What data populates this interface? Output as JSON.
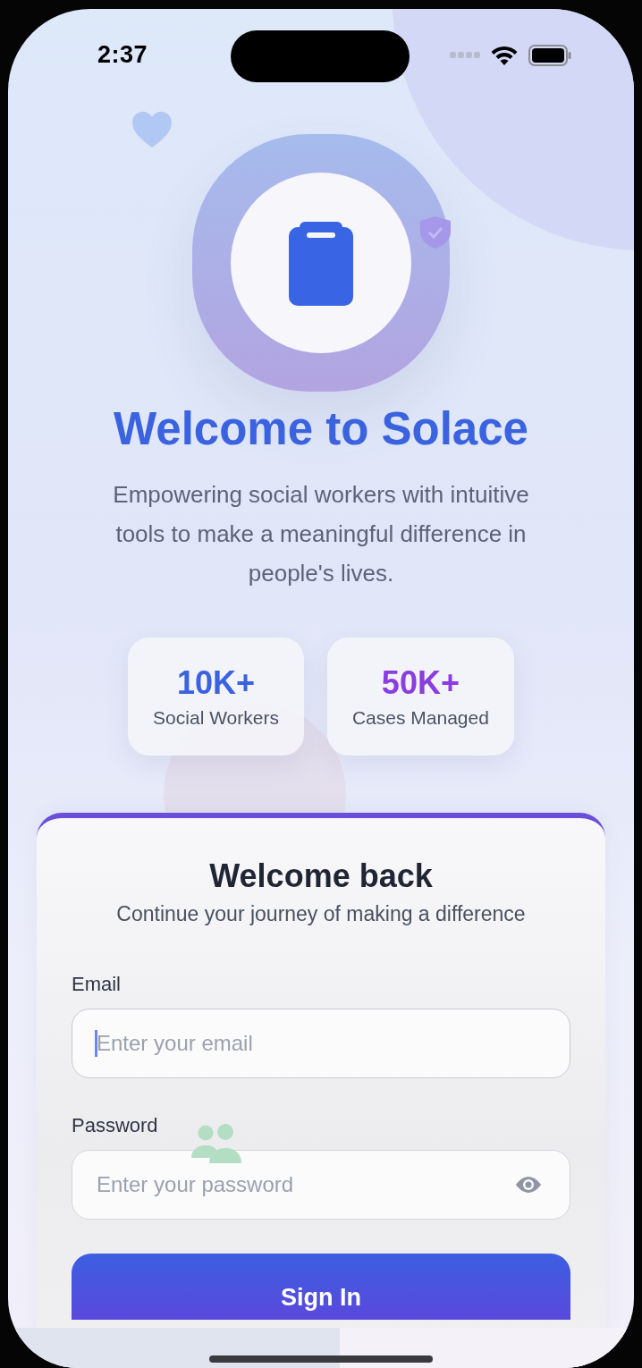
{
  "status_bar": {
    "time": "2:37"
  },
  "hero": {
    "title": "Welcome to Solace",
    "subtitle": "Empowering social workers with intuitive tools to make a meaningful difference in people's lives."
  },
  "stats": [
    {
      "value": "10K+",
      "label": "Social Workers",
      "color": "#3b63e0"
    },
    {
      "value": "50K+",
      "label": "Cases Managed",
      "color": "#8a3de0"
    }
  ],
  "login": {
    "title": "Welcome back",
    "subtitle": "Continue your journey of making a difference",
    "fields": [
      {
        "kind": "email",
        "label": "Email",
        "placeholder": "Enter your email",
        "focused": true
      },
      {
        "kind": "password",
        "label": "Password",
        "placeholder": "Enter your password",
        "focused": false
      }
    ],
    "button": "Sign In"
  }
}
